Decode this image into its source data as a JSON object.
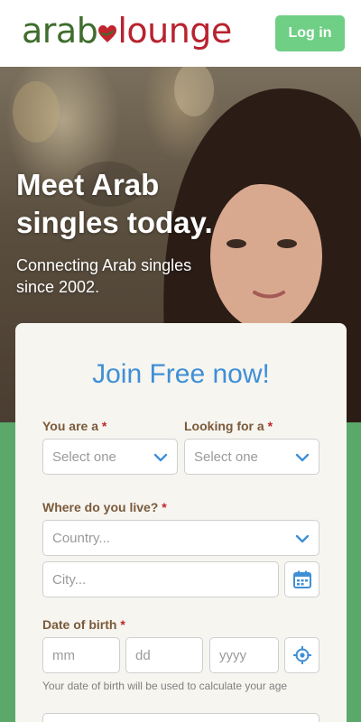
{
  "header": {
    "logo_part1": "arab",
    "logo_part2": "lounge",
    "login_label": "Log in"
  },
  "hero": {
    "title": "Meet Arab singles today.",
    "subtitle": "Connecting Arab singles since 2002."
  },
  "form": {
    "title": "Join Free now!",
    "you_are_label": "You are a",
    "looking_for_label": "Looking for a",
    "required_mark": "*",
    "select_placeholder": "Select one",
    "where_label": "Where do you live?",
    "country_placeholder": "Country...",
    "city_placeholder": "City...",
    "dob_label": "Date of birth",
    "mm_placeholder": "mm",
    "dd_placeholder": "dd",
    "yyyy_placeholder": "yyyy",
    "dob_hint": "Your date of birth will be used to calculate your age"
  },
  "colors": {
    "brand_green": "#3f6d2d",
    "brand_red": "#b8232f",
    "login_button": "#6fcf84",
    "title_blue": "#3f8fd6",
    "label_brown": "#7a5a3a",
    "required_red": "#c0252b",
    "page_green": "#5aa86a"
  },
  "icons": {
    "logo_heart": "heart-icon",
    "dropdown": "chevron-down-icon",
    "city_lookup": "calendar-icon",
    "locate": "crosshair-icon"
  }
}
